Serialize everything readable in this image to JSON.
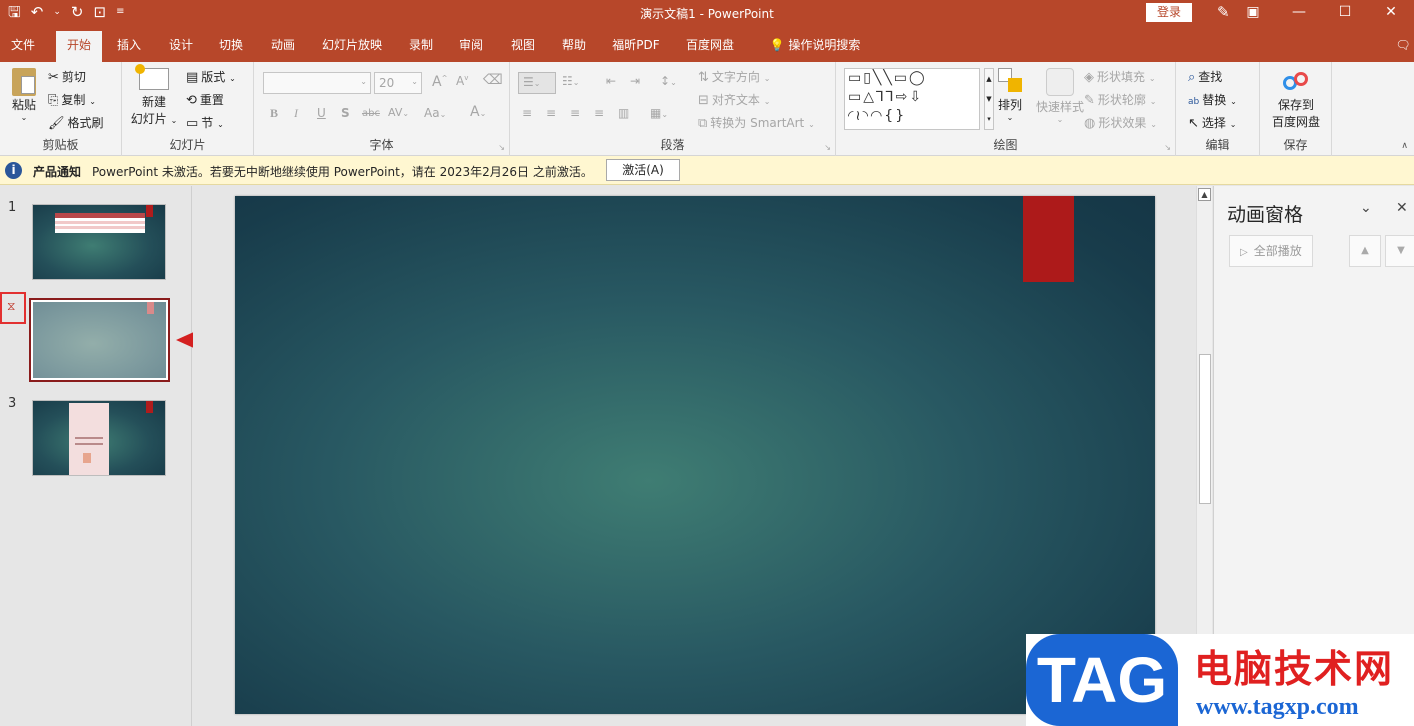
{
  "titlebar": {
    "title": "演示文稿1  -  PowerPoint",
    "login": "登录"
  },
  "tabs": [
    "文件",
    "开始",
    "插入",
    "设计",
    "切换",
    "动画",
    "幻灯片放映",
    "录制",
    "审阅",
    "视图",
    "帮助",
    "福昕PDF",
    "百度网盘"
  ],
  "tell_me": "操作说明搜索",
  "ribbon": {
    "clipboard": {
      "paste": "粘贴",
      "cut": "剪切",
      "copy": "复制",
      "format_painter": "格式刷",
      "label": "剪贴板"
    },
    "slides": {
      "new_slide_1": "新建",
      "new_slide_2": "幻灯片",
      "layout": "版式",
      "reset": "重置",
      "section": "节",
      "label": "幻灯片"
    },
    "font": {
      "size": "20",
      "label": "字体",
      "bold": "B",
      "italic": "I",
      "underline": "U",
      "shadow": "S",
      "strike": "abc",
      "spacing": "AV",
      "case": "Aa",
      "color": "A"
    },
    "paragraph": {
      "text_direction": "文字方向",
      "align_text": "对齐文本",
      "smartart": "转换为 SmartArt",
      "label": "段落"
    },
    "drawing": {
      "arrange": "排列",
      "quick_styles": "快速样式",
      "fill": "形状填充",
      "outline": "形状轮廓",
      "effects": "形状效果",
      "label": "绘图"
    },
    "editing": {
      "find": "查找",
      "replace": "替换",
      "select": "选择",
      "label": "编辑"
    },
    "save": {
      "save_1": "保存到",
      "save_2": "百度网盘",
      "label": "保存"
    }
  },
  "notice": {
    "label": "产品通知",
    "message": "PowerPoint 未激活。若要无中断地继续使用 PowerPoint，请在 2023年2月26日 之前激活。",
    "button": "激活(A)"
  },
  "thumbnails": {
    "n1": "1",
    "n3": "3"
  },
  "animation_pane": {
    "title": "动画窗格",
    "play_all": "全部播放"
  },
  "watermark": {
    "logo": "TAG",
    "site_cn": "电脑技术网",
    "url": "www.tagxp.com"
  }
}
